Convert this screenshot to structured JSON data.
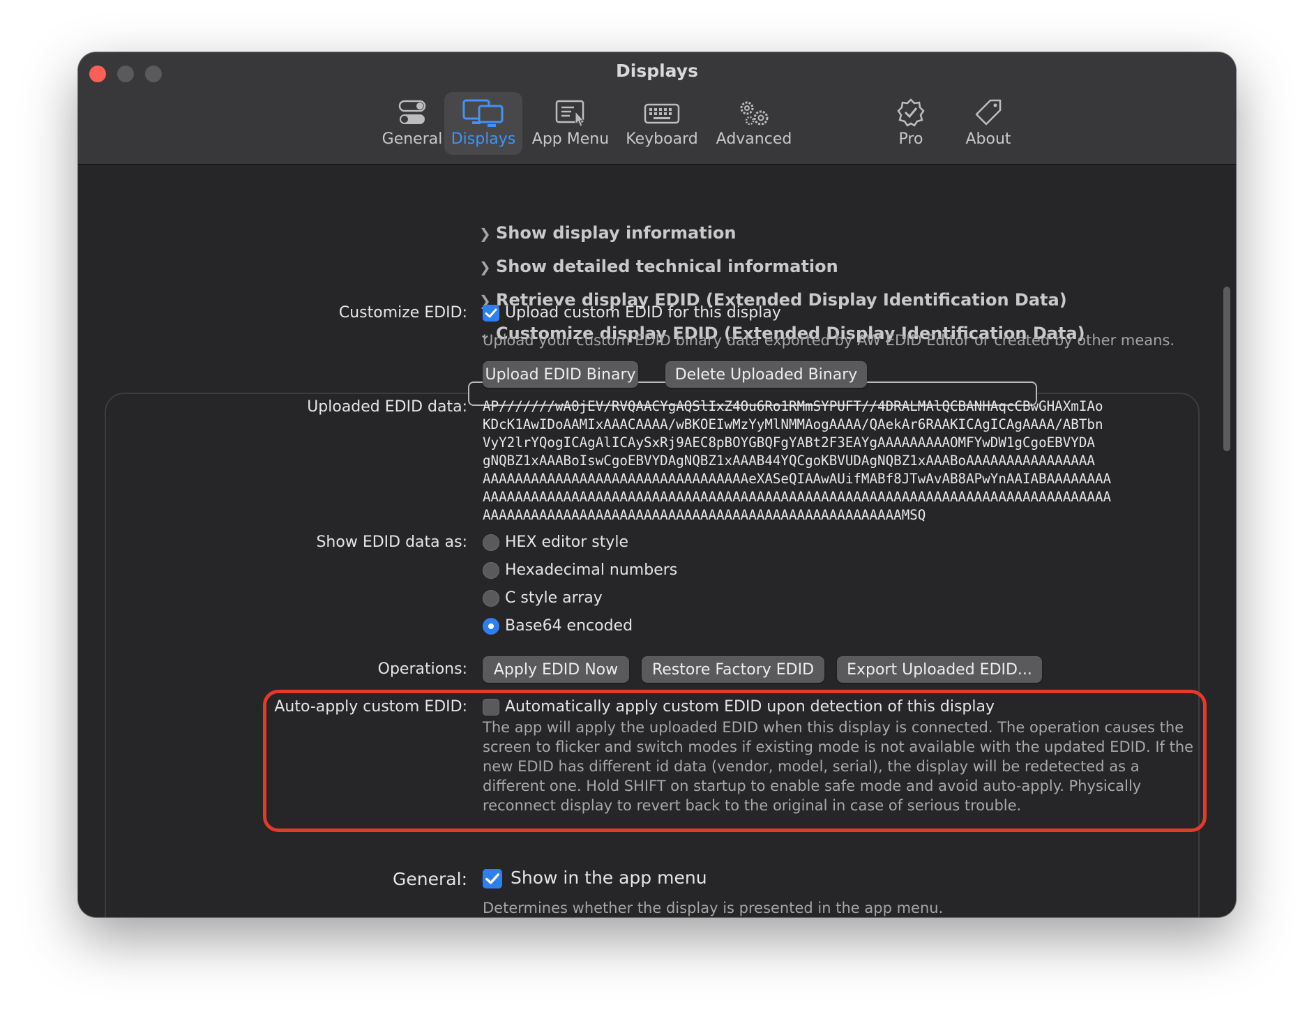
{
  "window": {
    "title": "Displays"
  },
  "toolbar": {
    "tabs": [
      {
        "label": "General",
        "icon": "toggles-icon"
      },
      {
        "label": "Displays",
        "icon": "displays-icon",
        "active": true
      },
      {
        "label": "App Menu",
        "icon": "app-menu-icon"
      },
      {
        "label": "Keyboard",
        "icon": "keyboard-icon"
      },
      {
        "label": "Advanced",
        "icon": "gears-icon"
      },
      {
        "label": "Pro",
        "icon": "pro-badge-icon"
      },
      {
        "label": "About",
        "icon": "tag-icon"
      }
    ]
  },
  "sections": {
    "show_info": "Show display information",
    "show_technical": "Show detailed technical information",
    "retrieve_edid": "Retrieve display EDID (Extended Display Identification Data)",
    "customize_edid": "Customize display EDID (Extended Display Identification Data)"
  },
  "customize": {
    "label": "Customize EDID:",
    "checkbox_label": "Upload custom EDID for this display",
    "checked": true,
    "hint": "Upload your custom EDID binary data exported by AW EDID Editor or created by other means.",
    "upload_button": "Upload EDID Binary",
    "delete_button": "Delete Uploaded Binary"
  },
  "uploaded": {
    "label": "Uploaded EDID data:",
    "lines": [
      "AP///////wA0jEV/RVQAACYgAQSlIxZ4Ou6Ro1RMmSYPUFT//4DRALMAlQCBANHAqcCBwGHAXmIAo",
      "KDcK1AwIDoAAMIxAAACAAAA/wBKOEIwMzYyMlNMMAogAAAA/QAekAr6RAAKICAgICAgAAAA/ABTbn",
      "VyY2lrYQogICAgAlICAySxRj9AEC8pBOYGBQFgYABt2F3EAYgAAAAAAAAAOMFYwDW1gCgoEBVYDA",
      "gNQBZ1xAAABoIswCgoEBVYDAgNQBZ1xAAAB44YQCgoKBVUDAgNQBZ1xAAABoAAAAAAAAAAAAAAAA",
      "AAAAAAAAAAAAAAAAAAAAAAAAAAAAAAAAAeXASeQIAAwAUifMABf8JTwAvAB8APwYnAAIABAAAAAAAA",
      "AAAAAAAAAAAAAAAAAAAAAAAAAAAAAAAAAAAAAAAAAAAAAAAAAAAAAAAAAAAAAAAAAAAAAAAAAAAAAA",
      "AAAAAAAAAAAAAAAAAAAAAAAAAAAAAAAAAAAAAAAAAAAAAAAAAAAAMSQ"
    ]
  },
  "show_as": {
    "label": "Show EDID data as:",
    "options": [
      "HEX editor style",
      "Hexadecimal numbers",
      "C style array",
      "Base64 encoded"
    ],
    "selected": "Base64 encoded"
  },
  "operations": {
    "label": "Operations:",
    "apply": "Apply EDID Now",
    "restore": "Restore Factory EDID",
    "export": "Export Uploaded EDID..."
  },
  "auto_apply": {
    "label": "Auto-apply custom EDID:",
    "checkbox_label": "Automatically apply custom EDID upon detection of this display",
    "checked": false,
    "description_lines": [
      "The app will apply the uploaded EDID when this display is connected. The operation causes the",
      "screen to flicker and switch modes if existing mode is not available with the updated EDID. If the",
      "new EDID has different id data (vendor, model, serial), the display will be redetected as a",
      "different one. Hold SHIFT on startup to enable safe mode and avoid auto-apply. Physically",
      "reconnect  display to revert back to the original in case of serious trouble."
    ]
  },
  "general": {
    "label": "General:",
    "checkbox_label": "Show in the app menu",
    "checked": true,
    "hint": "Determines whether the display is presented in the app menu."
  },
  "colors": {
    "accent": "#3f94f5",
    "highlight": "#e5392a",
    "window_bg": "#262628"
  }
}
